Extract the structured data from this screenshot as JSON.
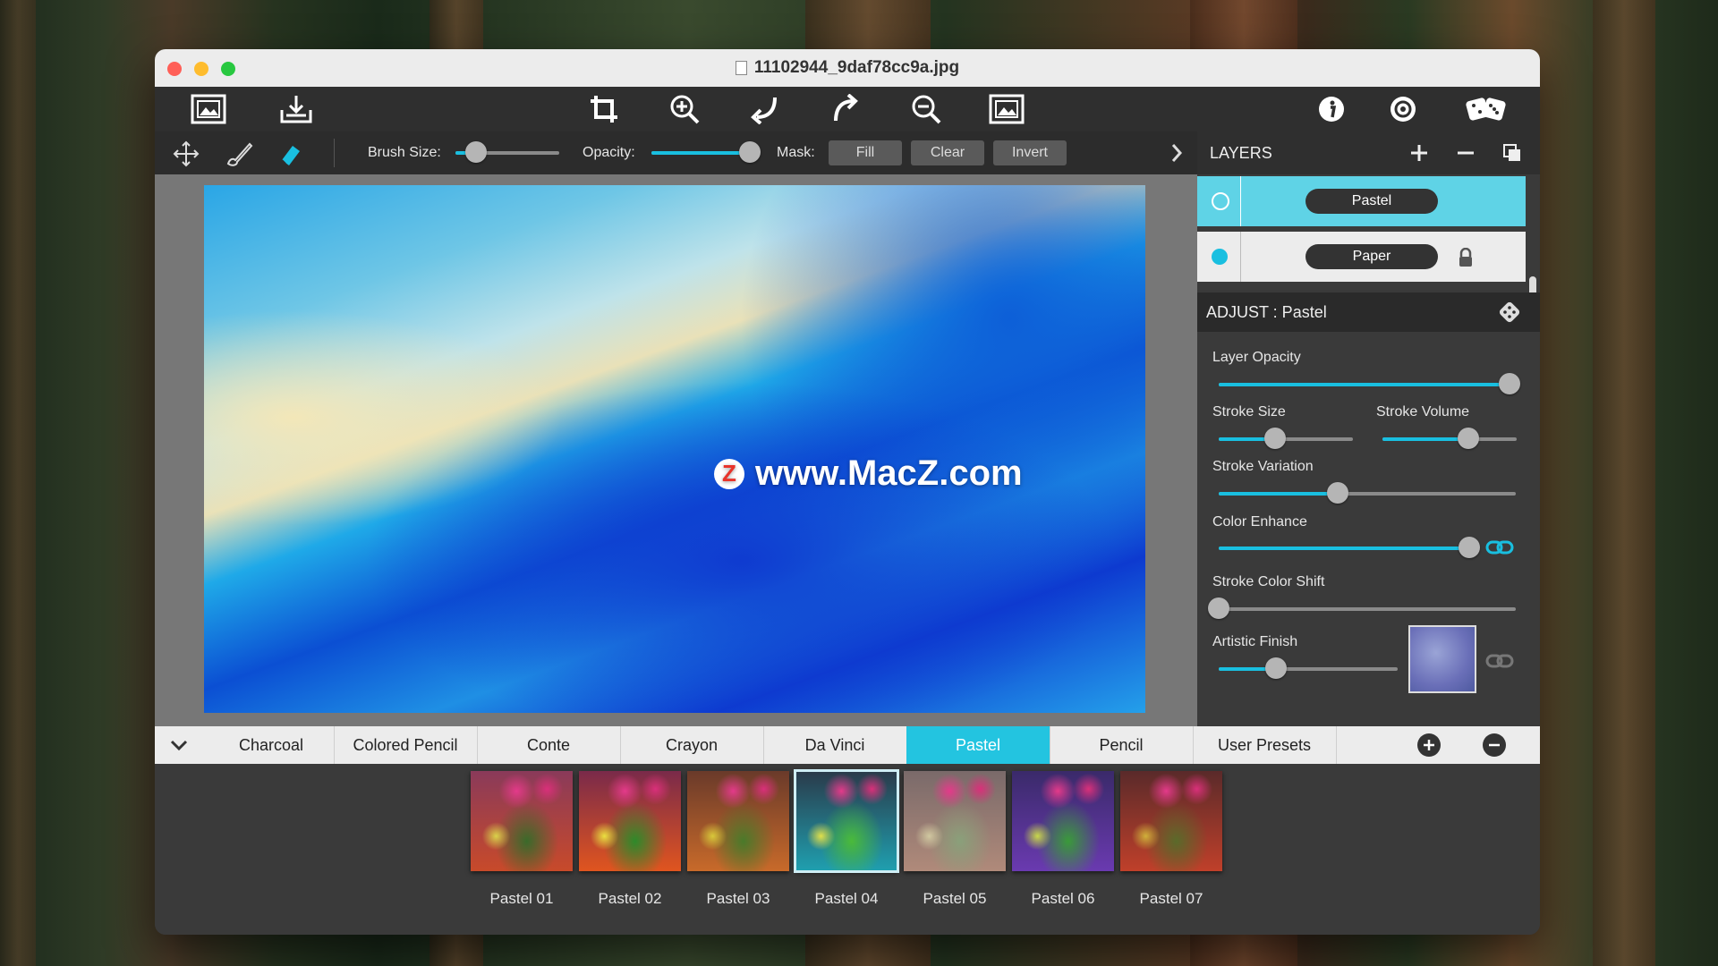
{
  "window": {
    "title": "11102944_9daf78cc9a.jpg"
  },
  "toolbar": {
    "left_icons": [
      "open-image-icon",
      "save-image-icon"
    ],
    "center_icons": [
      "crop-icon",
      "zoom-in-icon",
      "undo-icon",
      "redo-icon",
      "zoom-out-icon",
      "fit-image-icon"
    ],
    "right_icons": [
      "info-icon",
      "settings-icon",
      "randomize-dice-icon"
    ]
  },
  "subbar": {
    "brush_size_label": "Brush Size:",
    "opacity_label": "Opacity:",
    "mask_label": "Mask:",
    "fill_label": "Fill",
    "clear_label": "Clear",
    "invert_label": "Invert",
    "brush_size_value": 0.2,
    "opacity_value": 1.0
  },
  "canvas": {
    "watermark_badge": "Z",
    "watermark_text": "www.MacZ.com"
  },
  "layers": {
    "title": "LAYERS",
    "items": [
      {
        "name": "Pastel",
        "selected": true
      },
      {
        "name": "Paper",
        "selected": false,
        "locked": true
      }
    ]
  },
  "adjust": {
    "title": "ADJUST : Pastel",
    "layer_opacity": {
      "label": "Layer Opacity",
      "value": 0.98
    },
    "stroke_size": {
      "label": "Stroke Size",
      "value": 0.42
    },
    "stroke_volume": {
      "label": "Stroke Volume",
      "value": 0.64
    },
    "stroke_variation": {
      "label": "Stroke Variation",
      "value": 0.4
    },
    "color_enhance": {
      "label": "Color Enhance",
      "value": 0.98
    },
    "stroke_color_shift": {
      "label": "Stroke Color Shift",
      "value": 0.0
    },
    "artistic_finish": {
      "label": "Artistic Finish",
      "value": 0.32
    }
  },
  "tabs": {
    "items": [
      "Charcoal",
      "Colored Pencil",
      "Conte",
      "Crayon",
      "Da Vinci",
      "Pastel",
      "Pencil",
      "User Presets"
    ],
    "active": "Pastel"
  },
  "presets": {
    "items": [
      "Pastel 01",
      "Pastel 02",
      "Pastel 03",
      "Pastel 04",
      "Pastel 05",
      "Pastel 06",
      "Pastel 07"
    ],
    "selected": "Pastel 04"
  },
  "colors": {
    "accent": "#19bfe0",
    "active_tab": "#23c4e0",
    "close": "#ff5f57",
    "minimize": "#febc2e",
    "zoom": "#28c840"
  }
}
